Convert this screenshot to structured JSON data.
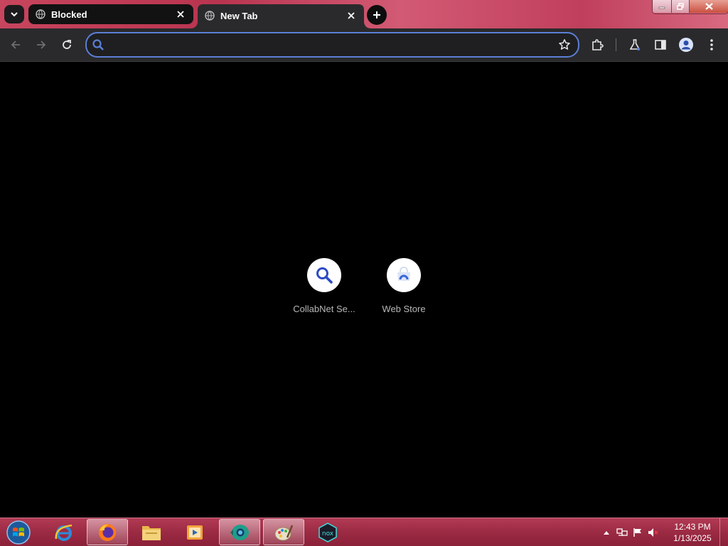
{
  "tabs": [
    {
      "title": "Blocked",
      "favicon": "globe-icon",
      "active": false
    },
    {
      "title": "New Tab",
      "favicon": "globe-icon",
      "active": true
    }
  ],
  "toolbar": {
    "omnibox_value": "",
    "omnibox_placeholder": ""
  },
  "shortcuts": [
    {
      "label": "CollabNet Se...",
      "icon": "search-icon"
    },
    {
      "label": "Web Store",
      "icon": "web-store-icon"
    }
  ],
  "taskbar": {
    "apps": [
      "internet-explorer-icon",
      "firefox-icon",
      "file-explorer-icon",
      "media-player-icon",
      "chrome-like-icon",
      "paint-icon",
      "nox-icon"
    ],
    "clock_time": "12:43 PM",
    "clock_date": "1/13/2025"
  },
  "colors": {
    "accent": "#5b7fd6",
    "toolbar_bg": "#2a2a2c",
    "titlebar": "#c8455e",
    "taskbar": "#9b2a43"
  }
}
